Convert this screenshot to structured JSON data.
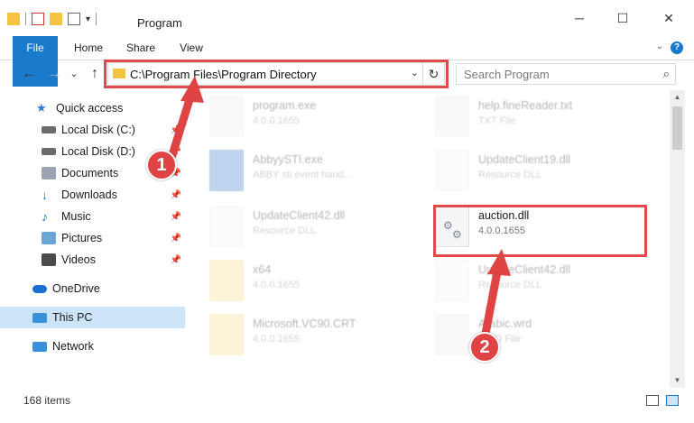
{
  "window": {
    "title": "Program",
    "minimize": "─",
    "maximize": "☐",
    "close": "✕"
  },
  "ribbon": {
    "tabs": [
      "File",
      "Home",
      "Share",
      "View"
    ],
    "help": "?"
  },
  "nav": {
    "back": "←",
    "forward": "→",
    "history": "⌄",
    "up": "↑"
  },
  "address": {
    "path": "C:\\Program Files\\Program Directory",
    "dropdown": "⌄",
    "refresh": "↻"
  },
  "search": {
    "placeholder": "Search Program",
    "icon": "⌕"
  },
  "sidebar": {
    "items": [
      {
        "label": "Quick access",
        "icon": "star-icon",
        "color": "#2b7bd3",
        "pinned": false
      },
      {
        "label": "Local Disk (C:)",
        "icon": "drive-icon",
        "color": "#6b6b6b",
        "pinned": true
      },
      {
        "label": "Local Disk (D:)",
        "icon": "drive-icon",
        "color": "#6b6b6b",
        "pinned": true
      },
      {
        "label": "Documents",
        "icon": "documents-icon",
        "color": "#9aa4b2",
        "pinned": true
      },
      {
        "label": "Downloads",
        "icon": "downloads-icon",
        "color": "#1b74d3",
        "pinned": true
      },
      {
        "label": "Music",
        "icon": "music-icon",
        "color": "#1b74d3",
        "pinned": true
      },
      {
        "label": "Pictures",
        "icon": "pictures-icon",
        "color": "#6aa6d8",
        "pinned": true
      },
      {
        "label": "Videos",
        "icon": "videos-icon",
        "color": "#4a4a4a",
        "pinned": true
      },
      {
        "label": "OneDrive",
        "icon": "onedrive-icon",
        "color": "#1b6fd0",
        "pinned": false
      },
      {
        "label": "This PC",
        "icon": "pc-icon",
        "color": "#3a8fd9",
        "pinned": false,
        "selected": true
      },
      {
        "label": "Network",
        "icon": "network-icon",
        "color": "#3a8fd9",
        "pinned": false
      }
    ]
  },
  "files": [
    {
      "name": "program.exe",
      "meta": "4.0.0.1655",
      "kind": "exe",
      "faded": true
    },
    {
      "name": "help.fineReader.txt",
      "meta": "TXT File",
      "kind": "doc",
      "faded": true
    },
    {
      "name": "AbbyySTI.exe",
      "meta": "ABBY sti event hand...",
      "kind": "exe",
      "faded": true
    },
    {
      "name": "UpdateClient19.dll",
      "meta": "Resource DLL",
      "kind": "dll",
      "faded": true
    },
    {
      "name": "UpdateClient42.dll",
      "meta": "Resource DLL",
      "kind": "dll",
      "faded": true
    },
    {
      "name": "auction.dll",
      "meta": "4.0.0.1655",
      "kind": "dll",
      "faded": false
    },
    {
      "name": "x64",
      "meta": "4.0.0.1655",
      "kind": "folder",
      "faded": true
    },
    {
      "name": "UpdateClient42.dll",
      "meta": "Resource DLL",
      "kind": "dll",
      "faded": true
    },
    {
      "name": "Microsoft.VC90.CRT",
      "meta": "4.0.0.1655",
      "kind": "folder",
      "faded": true
    },
    {
      "name": "Arabic.wrd",
      "meta": "WRD File",
      "kind": "doc",
      "faded": true
    }
  ],
  "status": {
    "count": "168 items"
  },
  "annotations": {
    "step1": "1",
    "step2": "2",
    "color": "#e04343"
  }
}
